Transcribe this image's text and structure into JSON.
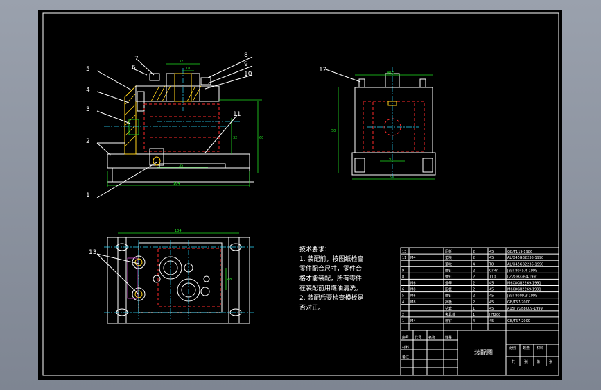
{
  "drawing": {
    "balloons": [
      "1",
      "2",
      "3",
      "4",
      "5",
      "6",
      "7",
      "8",
      "9",
      "10",
      "11",
      "12",
      "13"
    ],
    "dims": {
      "front_top": "32",
      "front_top_small": "18",
      "front_height": "60",
      "front_mid": "32",
      "front_bottom": "35",
      "front_total": "164",
      "side_top": "40.5",
      "side_height": "50",
      "side_inner": "30",
      "side_total": "91",
      "plan_width": "134",
      "plan_depth": "48"
    },
    "tech_requirements": {
      "title": "技术要求：",
      "lines": [
        "1. 装配前，按图纸检查",
        "零件配合尺寸，零件合",
        "格才能装配，所有零件",
        "在装配前用煤油清洗。",
        "2. 装配后要检查模板是",
        "否对正。"
      ]
    },
    "title_block": {
      "drawing_title": "装配图",
      "rows": [
        [
          "13",
          "",
          "压板",
          "2",
          "45",
          "GB/T119-1986"
        ],
        [
          "11",
          "M4",
          "垫块",
          "2",
          "45",
          "AL/X45GB2236-1990"
        ],
        [
          "",
          "",
          "垫块",
          "4",
          "T8",
          "AL/X45GB2236-1990"
        ],
        [
          "9",
          "",
          "螺钉",
          "2",
          "CrMn",
          "JB/T 8045.4-1999"
        ],
        [
          "8",
          "",
          "螺钉",
          "2",
          "T10",
          "LZ7GB2264-1991"
        ],
        [
          "",
          "M6",
          "螺母",
          "2",
          "45",
          "M6X8GB2269-1991"
        ],
        [
          "6",
          "M8",
          "压板",
          "2",
          "45",
          "M6X8GB2269-1991"
        ],
        [
          "5",
          "M6",
          "螺钉",
          "2",
          "45",
          "JB/T 8009.3-1999"
        ],
        [
          "4",
          "M8",
          "挡板",
          "2",
          "45",
          "GB/T67-2000"
        ],
        [
          "",
          "",
          "钻套",
          "1",
          "45",
          "A15/ 7GB8009-1999"
        ],
        [
          "2",
          "",
          "夹具体",
          "1",
          "HT200",
          ""
        ],
        [
          "1",
          "M4",
          "螺钉",
          "4",
          "45",
          "GB/T67-2000"
        ]
      ],
      "header_cells": [
        "序号",
        "代号",
        "名称",
        "数量",
        "材料",
        "备注"
      ],
      "right_cells": [
        "比例",
        "数量",
        "材料",
        "共",
        "张",
        "第",
        "张"
      ]
    }
  },
  "colors": {
    "background": "#000000",
    "line": "#ffffff",
    "dimension": "#22e022",
    "hidden": "#ff2a2a",
    "center": "#2ad9ff",
    "section": "#ffd21a"
  }
}
